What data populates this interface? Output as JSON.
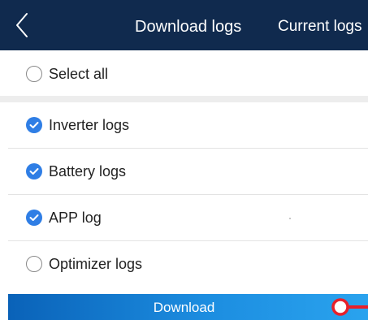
{
  "header": {
    "title": "Download logs",
    "right_action": "Current logs",
    "back_icon": "chevron-left-icon"
  },
  "select_all": {
    "label": "Select all",
    "checked": false
  },
  "logs": [
    {
      "label": "Inverter logs",
      "checked": true
    },
    {
      "label": "Battery logs",
      "checked": true
    },
    {
      "label": "APP log",
      "checked": true
    },
    {
      "label": "Optimizer logs",
      "checked": false
    }
  ],
  "footer": {
    "download_label": "Download"
  },
  "colors": {
    "header_bg": "#102a4e",
    "accent": "#2f7ee5",
    "footer_start": "#0a62b8",
    "footer_end": "#2aa3ee",
    "marker": "#e8202a"
  }
}
